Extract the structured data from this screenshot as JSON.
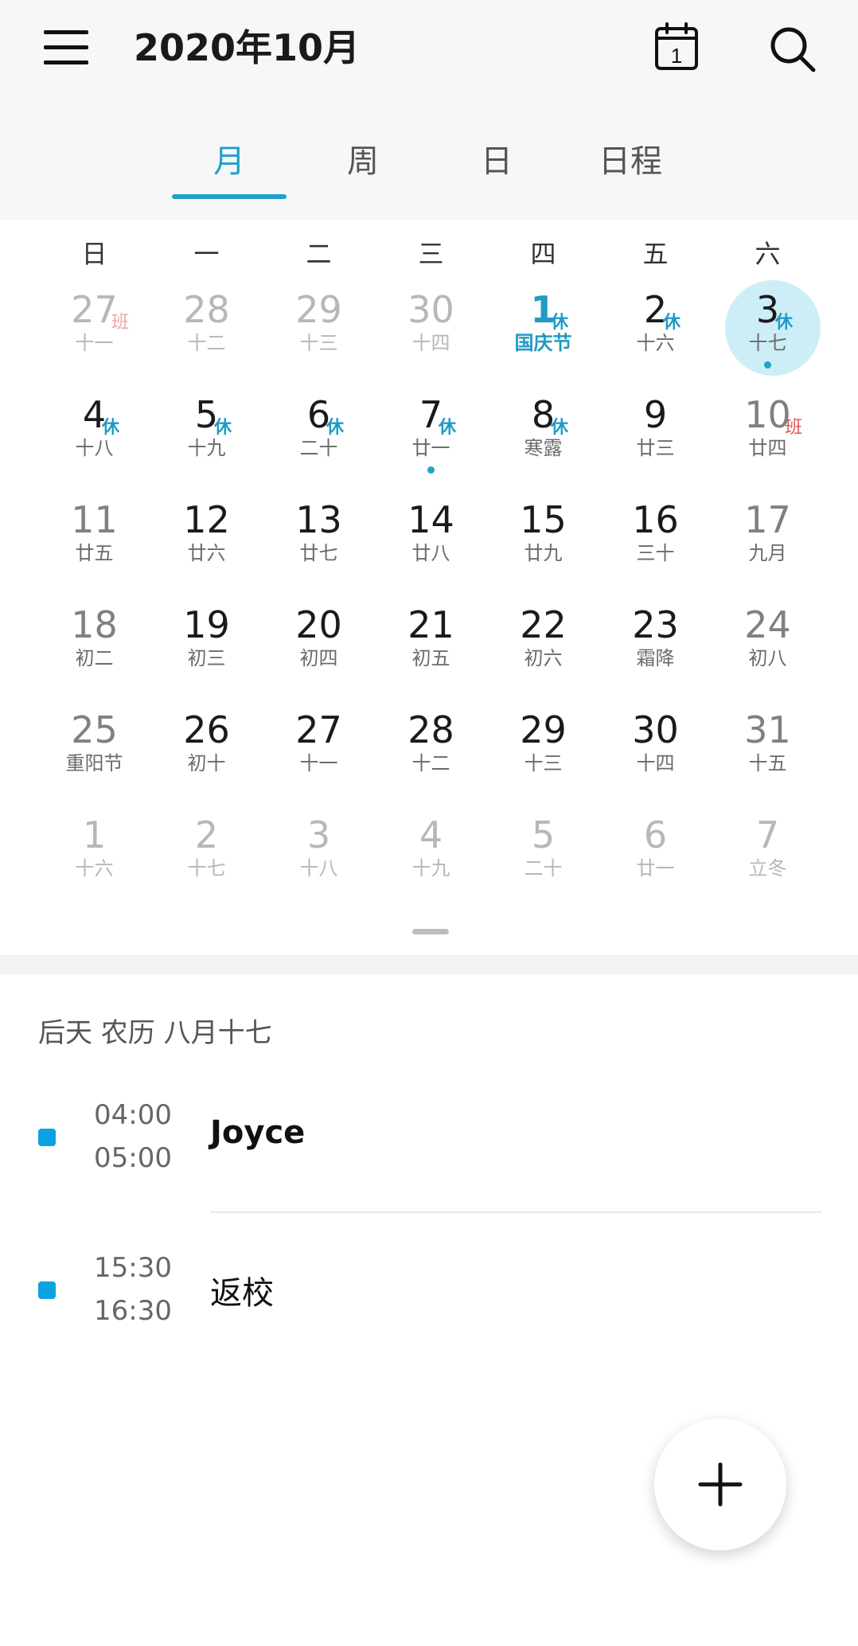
{
  "header": {
    "title": "2020年10月",
    "today_icon_day": "1"
  },
  "tabs": [
    {
      "label": "月",
      "active": true
    },
    {
      "label": "周",
      "active": false
    },
    {
      "label": "日",
      "active": false
    },
    {
      "label": "日程",
      "active": false
    }
  ],
  "weekdays": [
    "日",
    "一",
    "二",
    "三",
    "四",
    "五",
    "六"
  ],
  "calendar": {
    "accent_color": "#1fa1c9",
    "weeks": [
      [
        {
          "day": "27",
          "lunar": "十一",
          "badge": "班",
          "state": "muted",
          "badge_type": "work"
        },
        {
          "day": "28",
          "lunar": "十二",
          "state": "muted"
        },
        {
          "day": "29",
          "lunar": "十三",
          "state": "muted"
        },
        {
          "day": "30",
          "lunar": "十四",
          "state": "muted"
        },
        {
          "day": "1",
          "lunar": "国庆节",
          "badge": "休",
          "state": "festival",
          "badge_type": "rest"
        },
        {
          "day": "2",
          "lunar": "十六",
          "badge": "休",
          "badge_type": "rest"
        },
        {
          "day": "3",
          "lunar": "十七",
          "badge": "休",
          "badge_type": "rest",
          "selected": true,
          "has_event": true
        }
      ],
      [
        {
          "day": "4",
          "lunar": "十八",
          "badge": "休",
          "badge_type": "rest"
        },
        {
          "day": "5",
          "lunar": "十九",
          "badge": "休",
          "badge_type": "rest"
        },
        {
          "day": "6",
          "lunar": "二十",
          "badge": "休",
          "badge_type": "rest"
        },
        {
          "day": "7",
          "lunar": "廿一",
          "badge": "休",
          "badge_type": "rest",
          "has_event": true
        },
        {
          "day": "8",
          "lunar": "寒露",
          "badge": "休",
          "badge_type": "rest"
        },
        {
          "day": "9",
          "lunar": "廿三"
        },
        {
          "day": "10",
          "lunar": "廿四",
          "badge": "班",
          "badge_type": "work",
          "state": "weekend"
        }
      ],
      [
        {
          "day": "11",
          "lunar": "廿五",
          "state": "weekend"
        },
        {
          "day": "12",
          "lunar": "廿六"
        },
        {
          "day": "13",
          "lunar": "廿七"
        },
        {
          "day": "14",
          "lunar": "廿八"
        },
        {
          "day": "15",
          "lunar": "廿九"
        },
        {
          "day": "16",
          "lunar": "三十"
        },
        {
          "day": "17",
          "lunar": "九月",
          "state": "weekend"
        }
      ],
      [
        {
          "day": "18",
          "lunar": "初二",
          "state": "weekend"
        },
        {
          "day": "19",
          "lunar": "初三"
        },
        {
          "day": "20",
          "lunar": "初四"
        },
        {
          "day": "21",
          "lunar": "初五"
        },
        {
          "day": "22",
          "lunar": "初六"
        },
        {
          "day": "23",
          "lunar": "霜降"
        },
        {
          "day": "24",
          "lunar": "初八",
          "state": "weekend"
        }
      ],
      [
        {
          "day": "25",
          "lunar": "重阳节",
          "state": "weekend"
        },
        {
          "day": "26",
          "lunar": "初十"
        },
        {
          "day": "27",
          "lunar": "十一"
        },
        {
          "day": "28",
          "lunar": "十二"
        },
        {
          "day": "29",
          "lunar": "十三"
        },
        {
          "day": "30",
          "lunar": "十四"
        },
        {
          "day": "31",
          "lunar": "十五",
          "state": "weekend"
        }
      ],
      [
        {
          "day": "1",
          "lunar": "十六",
          "state": "muted"
        },
        {
          "day": "2",
          "lunar": "十七",
          "state": "muted"
        },
        {
          "day": "3",
          "lunar": "十八",
          "state": "muted"
        },
        {
          "day": "4",
          "lunar": "十九",
          "state": "muted"
        },
        {
          "day": "5",
          "lunar": "二十",
          "state": "muted"
        },
        {
          "day": "6",
          "lunar": "廿一",
          "state": "muted"
        },
        {
          "day": "7",
          "lunar": "立冬",
          "state": "muted"
        }
      ]
    ]
  },
  "agenda": {
    "header": "后天  农历 八月十七",
    "events": [
      {
        "start": "04:00",
        "end": "05:00",
        "title": "Joyce",
        "color": "#0aa3e0"
      },
      {
        "start": "15:30",
        "end": "16:30",
        "title": "返校",
        "color": "#0aa3e0"
      }
    ]
  },
  "icons": {
    "menu": "menu-icon",
    "today": "calendar-today-icon",
    "search": "search-icon",
    "add": "plus-icon"
  }
}
